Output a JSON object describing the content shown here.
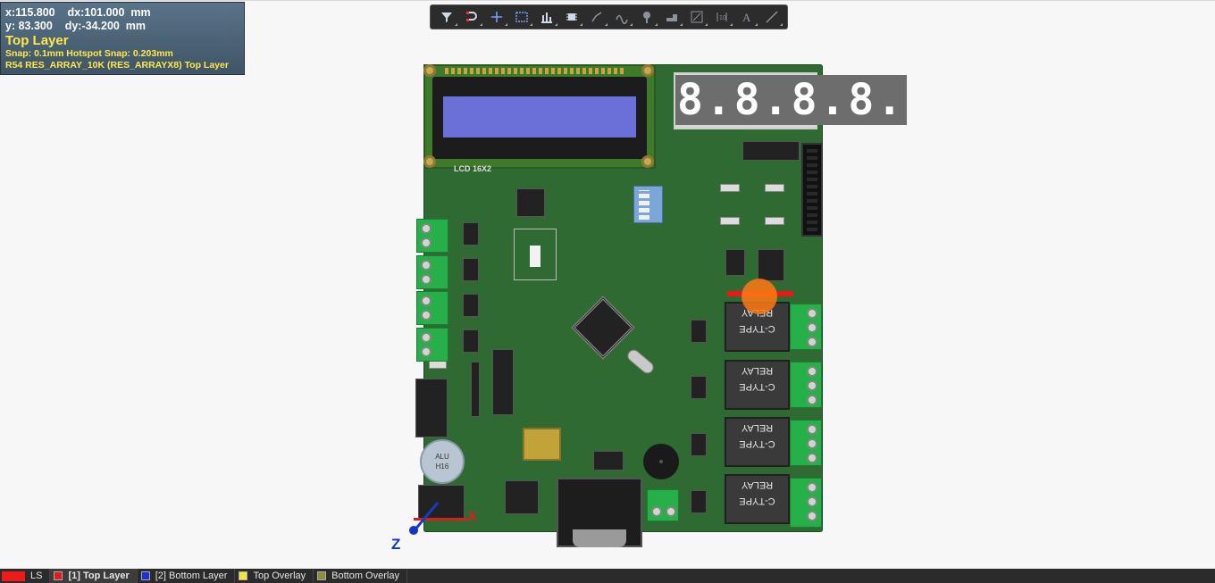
{
  "hud": {
    "line1": "x:115.800    dx:101.000  mm",
    "line2": "y: 83.300    dy:-34.200  mm",
    "layer": "Top Layer",
    "snap": "Snap: 0.1mm Hotspot Snap: 0.203mm",
    "selection": "R54 RES_ARRAY_10K (RES_ARRAYX8)  Top Layer"
  },
  "toolbar": {
    "tools": [
      "filter-icon",
      "route-icon",
      "cross-icon",
      "select-rect-icon",
      "chart-icon",
      "component-icon",
      "track-icon",
      "arc-icon",
      "pin-icon",
      "fill-icon",
      "edit-icon",
      "dimension-icon",
      "text-icon",
      "line-icon"
    ]
  },
  "board": {
    "lcd_label": "LCD 16X2",
    "seven_segment": "8.8.8.8.",
    "capacitor_label_1": "ALU",
    "capacitor_label_2": "H16",
    "relay_top": "C-TYPE",
    "relay_bottom": "RELAY"
  },
  "axes": {
    "z": "Z",
    "x": "X"
  },
  "layers": {
    "ls": "LS",
    "tabs": [
      {
        "label": "[1] Top Layer",
        "color": "#e01b1b"
      },
      {
        "label": "[2] Bottom Layer",
        "color": "#1b2ee0"
      },
      {
        "label": "Top Overlay",
        "color": "#f7e43b"
      },
      {
        "label": "Bottom Overlay",
        "color": "#8f8c3a"
      }
    ]
  }
}
